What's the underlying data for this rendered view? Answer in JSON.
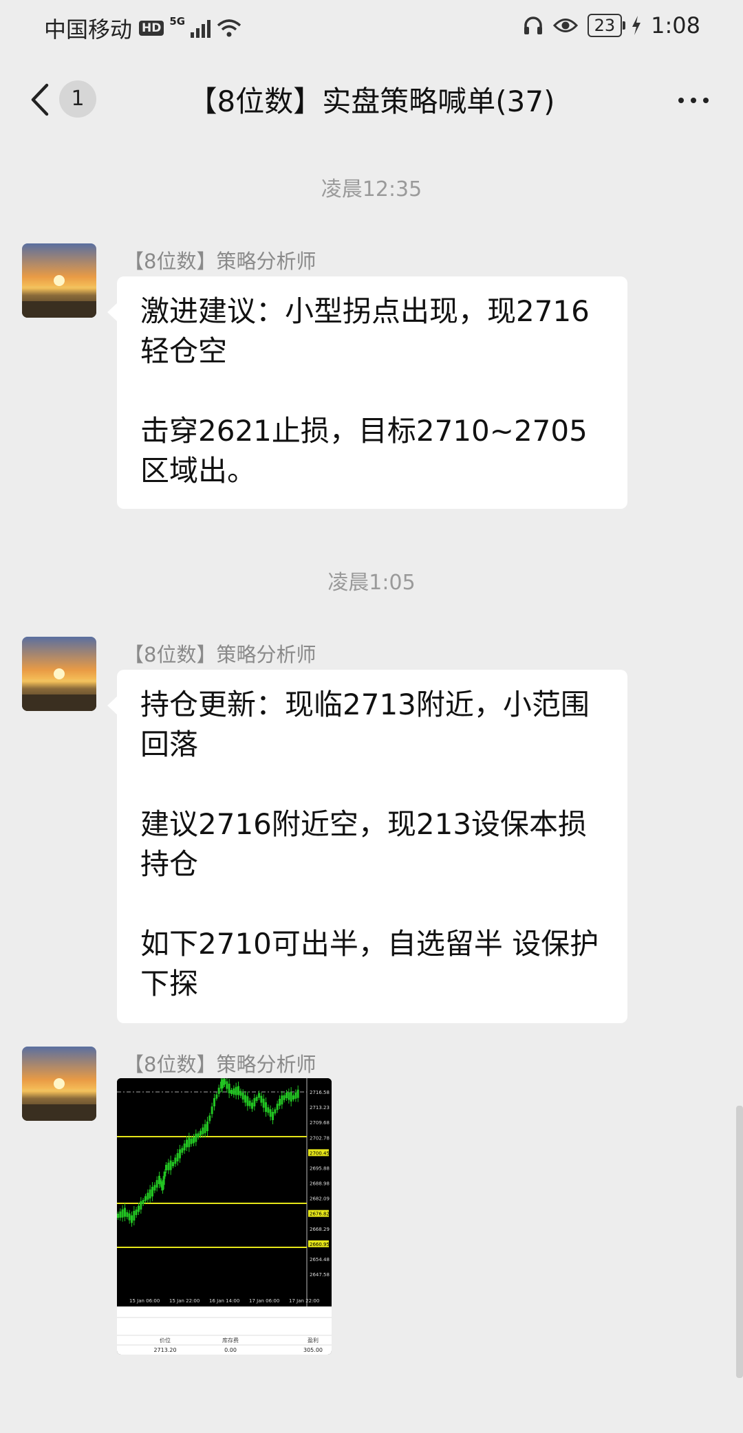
{
  "status_bar": {
    "carrier": "中国移动",
    "hd": "HD",
    "network": "5G",
    "battery": "23",
    "time": "1:08"
  },
  "nav": {
    "unread_count": "1",
    "title": "【8位数】实盘策略喊单(37)"
  },
  "messages": [
    {
      "timestamp": "凌晨12:35",
      "sender": "【8位数】策略分析师",
      "paragraphs": [
        "激进建议：小型拐点出现，现2716轻仓空",
        "击穿2621止损，目标2710~2705区域出。"
      ]
    },
    {
      "timestamp": "凌晨1:05",
      "sender": "【8位数】策略分析师",
      "paragraphs": [
        "持仓更新：现临2713附近，小范围回落",
        "建议2716附近空，现213设保本损 持仓",
        "如下2710可出半，自选留半 设保护下探"
      ]
    },
    {
      "sender": "【8位数】策略分析师",
      "image": {
        "price_labels": [
          "2716.58",
          "2713.23",
          "2709.68",
          "2702.78",
          "2700.45",
          "2695.88",
          "2688.98",
          "2682.09",
          "2676.82",
          "2668.29",
          "2660.95",
          "2654.48",
          "2647.58"
        ],
        "time_labels": [
          "15 Jan 06:00",
          "15 Jan 22:00",
          "16 Jan 14:00",
          "17 Jan 06:00",
          "17 Jan 22:00"
        ],
        "table_headers": [
          "价位",
          "库存费",
          "盈利"
        ],
        "table_values": [
          "2713.20",
          "0.00",
          "305.00"
        ]
      }
    }
  ],
  "colors": {
    "background": "#ededed",
    "bubble": "#ffffff",
    "chart_bg": "#000000",
    "candle": "#22c322",
    "level_line": "#e6e619"
  }
}
